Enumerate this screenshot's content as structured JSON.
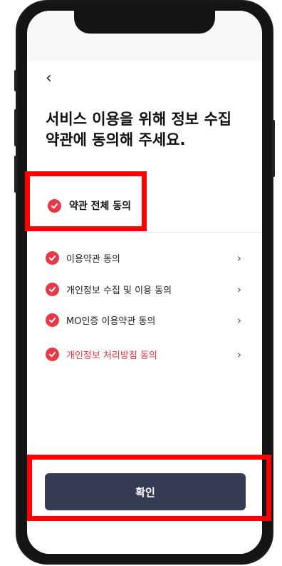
{
  "header": {
    "back_icon": "chevron-left-icon",
    "back_glyph": "‹"
  },
  "title": "서비스 이용을 위해 정보 수집\n약관에 동의해 주세요.",
  "agree_all": {
    "label": "약관 전체 동의",
    "checked": true
  },
  "terms": [
    {
      "label": "이용약관 동의",
      "checked": true
    },
    {
      "label": "개인정보 수집 및 이용 동의",
      "checked": true
    },
    {
      "label": "MO인증 이용약관 동의",
      "checked": true
    },
    {
      "label": "개인정보 처리방침 동의",
      "checked": true,
      "color": "#e63946"
    }
  ],
  "chevron_glyph": "›",
  "confirm_button": {
    "label": "확인"
  },
  "colors": {
    "accent": "#e63946",
    "button_bg": "#363b54",
    "highlight": "#ff0000"
  }
}
